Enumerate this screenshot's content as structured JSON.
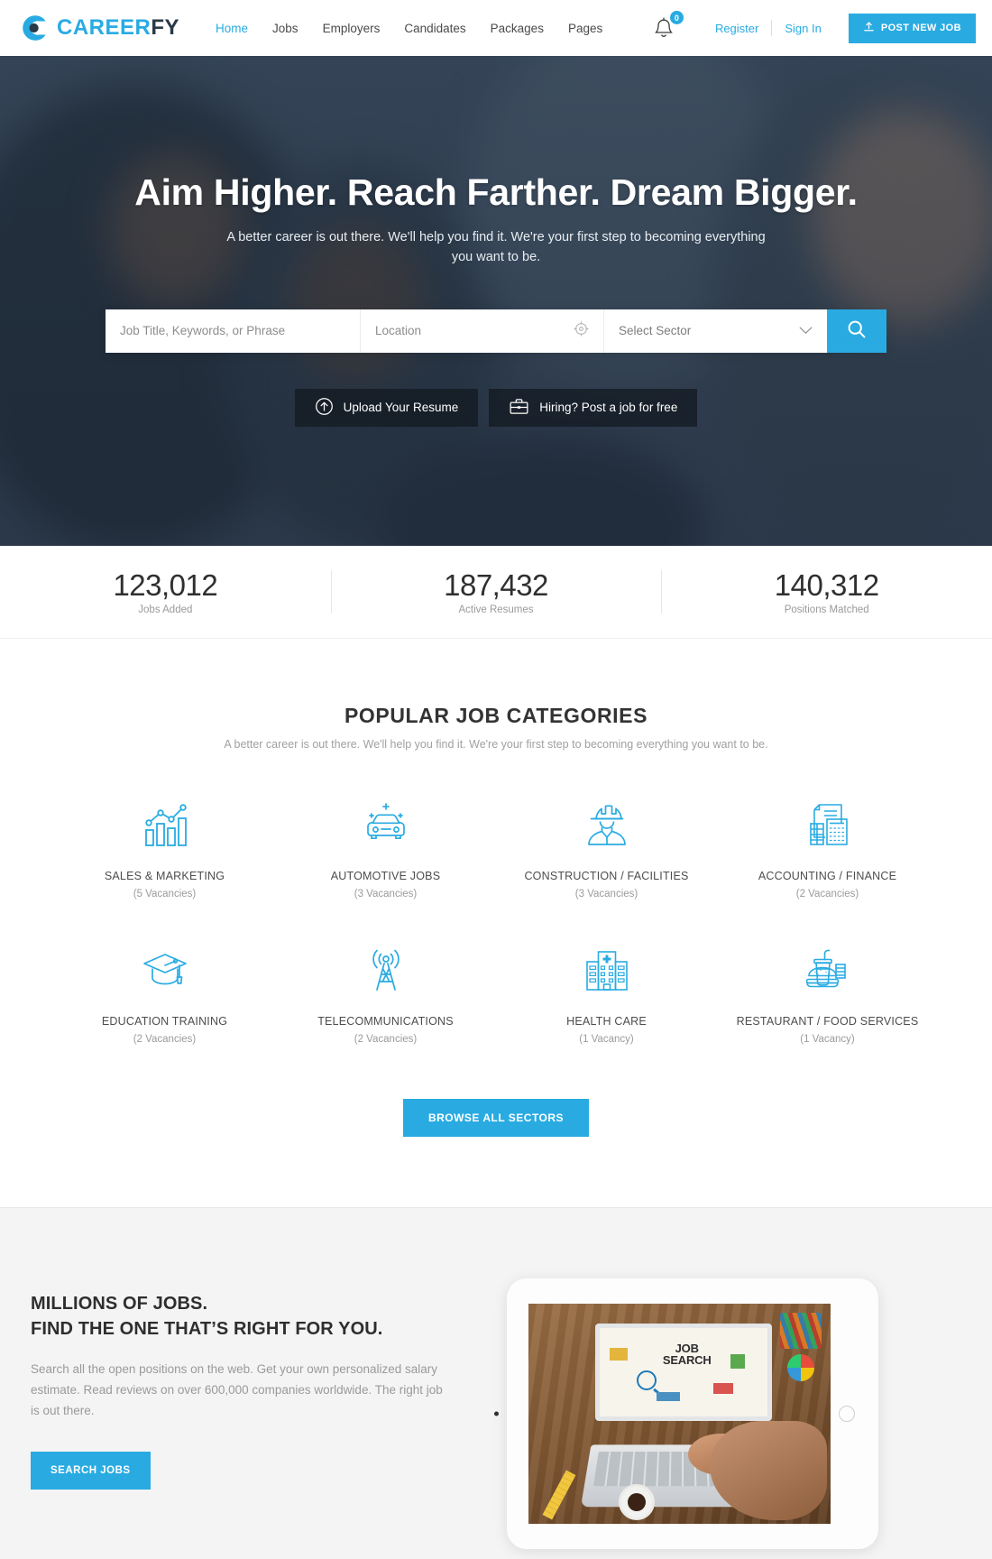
{
  "header": {
    "logo": {
      "icon": "careerfy-ring-logo",
      "text_primary": "CAREER",
      "text_secondary": "FY"
    },
    "nav": [
      {
        "label": "Home",
        "active": true
      },
      {
        "label": "Jobs",
        "active": false
      },
      {
        "label": "Employers",
        "active": false
      },
      {
        "label": "Candidates",
        "active": false
      },
      {
        "label": "Packages",
        "active": false
      },
      {
        "label": "Pages",
        "active": false
      }
    ],
    "notifications": {
      "icon": "bell-icon",
      "count": "0",
      "badge_color": "#29ABE2"
    },
    "register_label": "Register",
    "signin_label": "Sign In",
    "post_job": {
      "label": "POST NEW JOB",
      "icon": "upload-icon",
      "color": "#29ABE2"
    }
  },
  "hero": {
    "title": "Aim Higher. Reach Farther. Dream Bigger.",
    "subtitle": "A better career is out there. We'll help you find it. We're your first step to becoming everything you want to be.",
    "search": {
      "keyword_placeholder": "Job Title, Keywords, or Phrase",
      "keyword_value": "",
      "location_placeholder": "Location",
      "location_value": "",
      "geo_icon": "crosshair-locate-icon",
      "sector_selected": "Select Sector",
      "sector_chevron": "chevron-down-icon",
      "submit_icon": "search-icon"
    },
    "actions": [
      {
        "label": "Upload Your Resume",
        "icon": "upload-circle-icon"
      },
      {
        "label": "Hiring? Post a job for free",
        "icon": "briefcase-icon"
      }
    ]
  },
  "stats": [
    {
      "number": "123,012",
      "label": "Jobs Added"
    },
    {
      "number": "187,432",
      "label": "Active Resumes"
    },
    {
      "number": "140,312",
      "label": "Positions Matched"
    }
  ],
  "categories_section": {
    "title": "POPULAR JOB CATEGORIES",
    "subtitle": "A better career is out there. We'll help you find it. We're your first step to becoming everything you want to be.",
    "browse_label": "BROWSE ALL SECTORS",
    "items": [
      {
        "name": "SALES & MARKETING",
        "vacancies": "(5 Vacancies)",
        "icon": "bar-chart-growth-icon"
      },
      {
        "name": "AUTOMOTIVE JOBS",
        "vacancies": "(3 Vacancies)",
        "icon": "car-sparkle-icon"
      },
      {
        "name": "CONSTRUCTION / FACILITIES",
        "vacancies": "(3 Vacancies)",
        "icon": "worker-helmet-icon"
      },
      {
        "name": "ACCOUNTING / FINANCE",
        "vacancies": "(2 Vacancies)",
        "icon": "calculator-document-icon"
      },
      {
        "name": "EDUCATION TRAINING",
        "vacancies": "(2 Vacancies)",
        "icon": "graduation-cap-icon"
      },
      {
        "name": "TELECOMMUNICATIONS",
        "vacancies": "(2 Vacancies)",
        "icon": "signal-tower-icon"
      },
      {
        "name": "HEALTH CARE",
        "vacancies": "(1 Vacancy)",
        "icon": "hospital-building-icon"
      },
      {
        "name": "RESTAURANT / FOOD SERVICES",
        "vacancies": "(1 Vacancy)",
        "icon": "burger-drink-icon"
      }
    ]
  },
  "promo": {
    "heading_line1": "MILLIONS OF JOBS.",
    "heading_line2": "FIND THE ONE THAT’S RIGHT FOR YOU.",
    "paragraph": "Search all the open positions on the web. Get your own personalized salary estimate. Read reviews on over 600,000 companies worldwide. The right job is out there.",
    "button_label": "SEARCH JOBS",
    "image_alt": "job-search-laptop-photo"
  },
  "theme": {
    "accent": "#29ABE2",
    "dark": "#2b3a47",
    "muted": "#9a9a9a"
  }
}
